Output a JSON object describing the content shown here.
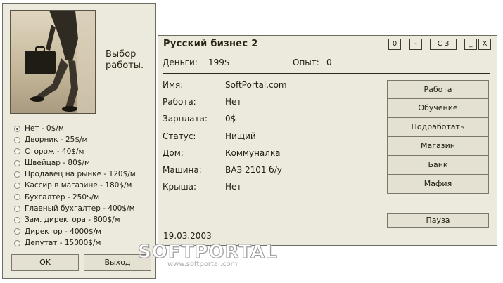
{
  "job_window": {
    "title": "Выбор\nработы.",
    "jobs": [
      {
        "label": "Нет - 0$/м",
        "selected": true
      },
      {
        "label": "Дворник - 25$/м",
        "selected": false
      },
      {
        "label": "Сторож - 40$/м",
        "selected": false
      },
      {
        "label": "Швейцар - 80$/м",
        "selected": false
      },
      {
        "label": "Продавец на рынке - 120$/м",
        "selected": false
      },
      {
        "label": "Кассир в магазине - 180$/м",
        "selected": false
      },
      {
        "label": "Бухгалтер - 250$/м",
        "selected": false
      },
      {
        "label": "Главный бухгалтер - 400$/м",
        "selected": false
      },
      {
        "label": "Зам. директора - 800$/м",
        "selected": false
      },
      {
        "label": "Директор - 4000$/м",
        "selected": false
      },
      {
        "label": "Депутат - 15000$/м",
        "selected": false
      }
    ],
    "ok_label": "OK",
    "exit_label": "Выход"
  },
  "main_window": {
    "title": "Русский бизнес 2",
    "titlebar_buttons": {
      "zero": "0",
      "minimize": "-",
      "cz": "С З",
      "underscore": "_",
      "close": "X"
    },
    "stats": {
      "money_label": "Деньги:",
      "money_value": "199$",
      "exp_label": "Опыт:",
      "exp_value": "0"
    },
    "info": [
      {
        "label": "Имя:",
        "value": "SoftPortal.com"
      },
      {
        "label": "Работа:",
        "value": "Нет"
      },
      {
        "label": "Зарплата:",
        "value": "0$"
      },
      {
        "label": "Статус:",
        "value": "Нищий"
      },
      {
        "label": "Дом:",
        "value": "Коммуналка"
      },
      {
        "label": "Машина:",
        "value": "ВАЗ 2101 б/у"
      },
      {
        "label": "Крыша:",
        "value": "Нет"
      }
    ],
    "menu_buttons": [
      "Работа",
      "Обучение",
      "Подработать",
      "Магазин",
      "Банк",
      "Мафия"
    ],
    "pause_label": "Пауза",
    "date": "19.03.2003"
  },
  "watermark": {
    "logo": "SOFTPORTAL",
    "url": "www.softportal.com"
  },
  "colors": {
    "window_bg": "#ece9dd",
    "button_bg": "#e4e1d2",
    "border": "#6e6c62",
    "text": "#1e1e14"
  }
}
